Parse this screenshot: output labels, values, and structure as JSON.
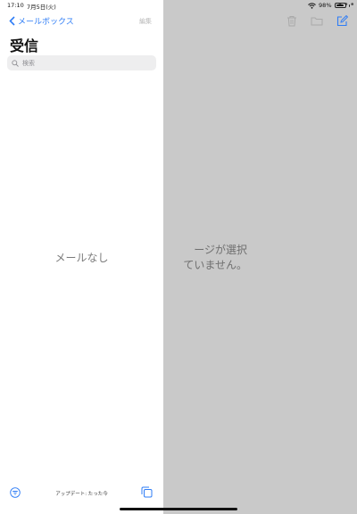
{
  "status": {
    "time": "17:10",
    "date": "7月5日(火)",
    "battery": "98%",
    "battery_level": 0.98
  },
  "sidebar": {
    "back_label": "メールボックス",
    "edit_label": "編集",
    "title": "受信",
    "search_placeholder": "検索",
    "empty_text": "メールなし",
    "update_text": "アップデート: たった今"
  },
  "detail": {
    "message_line1": "ージが選択",
    "message_line2": "ていません。"
  },
  "colors": {
    "accent": "#2f7df6",
    "detail_background": "#c9c9c9"
  },
  "icons": {
    "back": "chevron-left-icon",
    "search": "magnifier-icon",
    "trash": "trash-icon",
    "folder": "folder-icon",
    "compose": "compose-icon",
    "filter": "filter-icon",
    "stacked_windows": "stacked-windows-icon",
    "wifi": "wifi-icon",
    "battery": "battery-icon"
  }
}
